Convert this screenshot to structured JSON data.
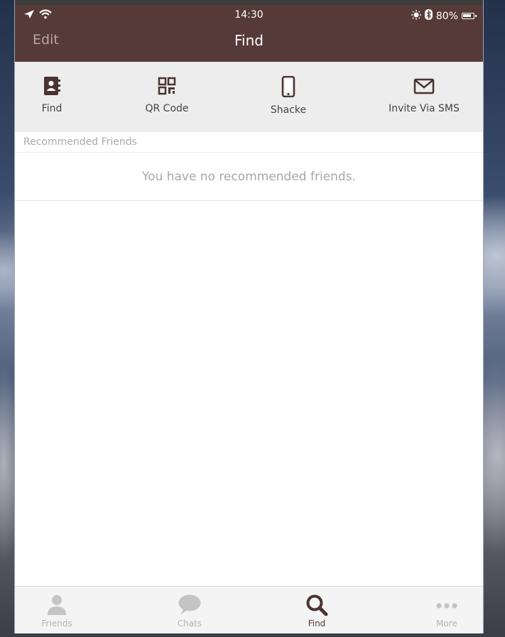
{
  "status_bar": {
    "time": "14:30",
    "battery": "80%"
  },
  "header": {
    "edit_label": "Edit",
    "title": "Find"
  },
  "toolbar": {
    "items": [
      {
        "label": "Find",
        "icon": "contacts-book-icon"
      },
      {
        "label": "QR Code",
        "icon": "qr-code-icon"
      },
      {
        "label": "Shacke",
        "icon": "phone-icon"
      },
      {
        "label": "Invite Via SMS",
        "icon": "envelope-icon"
      }
    ]
  },
  "recommended": {
    "section_title": "Recommended Friends",
    "empty_message": "You have no recommended friends."
  },
  "tabbar": {
    "tabs": [
      {
        "label": "Friends",
        "icon": "person-icon",
        "active": false
      },
      {
        "label": "Chats",
        "icon": "chat-bubble-icon",
        "active": false
      },
      {
        "label": "Find",
        "icon": "search-icon",
        "active": true
      },
      {
        "label": "More",
        "icon": "ellipsis-icon",
        "active": false
      }
    ]
  },
  "colors": {
    "brand": "#563a37",
    "toolbar_bg": "#ededed",
    "inactive_tab": "#b4b4b4"
  }
}
